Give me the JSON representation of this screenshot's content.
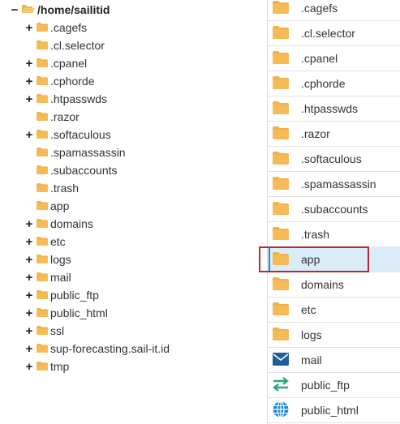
{
  "tree": {
    "root": {
      "label": "/home/sailitid",
      "toggle": "−"
    },
    "items": [
      {
        "label": ".cagefs",
        "toggle": "+"
      },
      {
        "label": ".cl.selector",
        "toggle": ""
      },
      {
        "label": ".cpanel",
        "toggle": "+"
      },
      {
        "label": ".cphorde",
        "toggle": "+"
      },
      {
        "label": ".htpasswds",
        "toggle": "+"
      },
      {
        "label": ".razor",
        "toggle": ""
      },
      {
        "label": ".softaculous",
        "toggle": "+"
      },
      {
        "label": ".spamassassin",
        "toggle": ""
      },
      {
        "label": ".subaccounts",
        "toggle": ""
      },
      {
        "label": ".trash",
        "toggle": ""
      },
      {
        "label": "app",
        "toggle": ""
      },
      {
        "label": "domains",
        "toggle": "+"
      },
      {
        "label": "etc",
        "toggle": "+"
      },
      {
        "label": "logs",
        "toggle": "+"
      },
      {
        "label": "mail",
        "toggle": "+"
      },
      {
        "label": "public_ftp",
        "toggle": "+"
      },
      {
        "label": "public_html",
        "toggle": "+"
      },
      {
        "label": "ssl",
        "toggle": "+"
      },
      {
        "label": "sup-forecasting.sail-it.id",
        "toggle": "+"
      },
      {
        "label": "tmp",
        "toggle": "+"
      }
    ]
  },
  "list": {
    "items": [
      {
        "name": ".cagefs",
        "icon": "folder-icon"
      },
      {
        "name": ".cl.selector",
        "icon": "folder-icon"
      },
      {
        "name": ".cpanel",
        "icon": "folder-icon"
      },
      {
        "name": ".cphorde",
        "icon": "folder-icon"
      },
      {
        "name": ".htpasswds",
        "icon": "folder-icon"
      },
      {
        "name": ".razor",
        "icon": "folder-icon"
      },
      {
        "name": ".softaculous",
        "icon": "folder-icon"
      },
      {
        "name": ".spamassassin",
        "icon": "folder-icon"
      },
      {
        "name": ".subaccounts",
        "icon": "folder-icon"
      },
      {
        "name": ".trash",
        "icon": "folder-icon"
      },
      {
        "name": "app",
        "icon": "folder-icon",
        "selected": true
      },
      {
        "name": "domains",
        "icon": "folder-icon"
      },
      {
        "name": "etc",
        "icon": "folder-icon"
      },
      {
        "name": "logs",
        "icon": "folder-icon"
      },
      {
        "name": "mail",
        "icon": "mail-envelope-icon"
      },
      {
        "name": "public_ftp",
        "icon": "transfer-arrows-icon"
      },
      {
        "name": "public_html",
        "icon": "globe-icon"
      }
    ]
  },
  "colors": {
    "folder": "#f0b24b",
    "selected_row": "#d9ecf8",
    "selection_bar": "#2a8ad4",
    "highlight_border": "#c0262d",
    "mail": "#1f5f9e",
    "ftp": "#2aa87a",
    "globe": "#1e88d8"
  }
}
